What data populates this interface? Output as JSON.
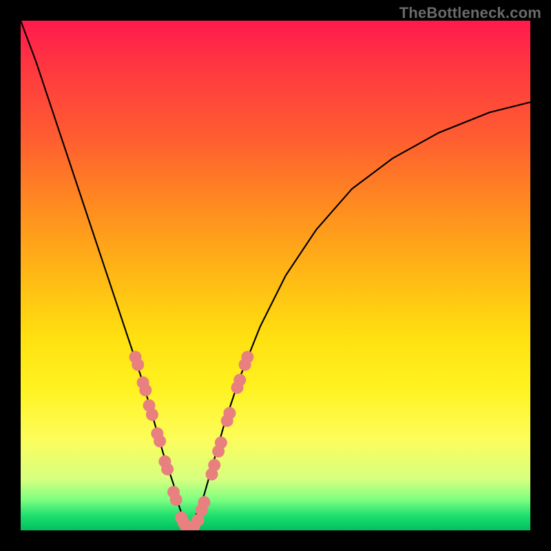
{
  "watermark": "TheBottleneck.com",
  "chart_data": {
    "type": "line",
    "title": "",
    "xlabel": "",
    "ylabel": "",
    "xlim": [
      0,
      100
    ],
    "ylim": [
      0,
      100
    ],
    "x": [
      0,
      3,
      6,
      9,
      12,
      15,
      18,
      21,
      24,
      26,
      28,
      30,
      31,
      32,
      33,
      34,
      36,
      38,
      40,
      43,
      47,
      52,
      58,
      65,
      73,
      82,
      92,
      100
    ],
    "values": [
      100,
      92,
      83,
      74,
      65,
      56,
      47,
      38,
      29,
      22,
      15,
      9,
      5,
      2,
      0,
      2,
      7,
      14,
      21,
      30,
      40,
      50,
      59,
      67,
      73,
      78,
      82,
      84
    ],
    "annotations": [
      {
        "x": 22.5,
        "y": 34
      },
      {
        "x": 23.0,
        "y": 32.5
      },
      {
        "x": 24.0,
        "y": 29
      },
      {
        "x": 24.5,
        "y": 27.5
      },
      {
        "x": 25.2,
        "y": 24.5
      },
      {
        "x": 25.8,
        "y": 22.7
      },
      {
        "x": 26.8,
        "y": 19
      },
      {
        "x": 27.3,
        "y": 17.5
      },
      {
        "x": 28.3,
        "y": 13.5
      },
      {
        "x": 28.8,
        "y": 12
      },
      {
        "x": 30.0,
        "y": 7.5
      },
      {
        "x": 30.5,
        "y": 6
      },
      {
        "x": 31.5,
        "y": 2.5
      },
      {
        "x": 32.0,
        "y": 1.5
      },
      {
        "x": 32.5,
        "y": 0.6
      },
      {
        "x": 33.2,
        "y": 0.3
      },
      {
        "x": 34.0,
        "y": 0.8
      },
      {
        "x": 34.8,
        "y": 2.0
      },
      {
        "x": 35.5,
        "y": 4.0
      },
      {
        "x": 36.0,
        "y": 5.5
      },
      {
        "x": 37.5,
        "y": 11
      },
      {
        "x": 38.0,
        "y": 12.8
      },
      {
        "x": 38.8,
        "y": 15.5
      },
      {
        "x": 39.3,
        "y": 17.2
      },
      {
        "x": 40.5,
        "y": 21.5
      },
      {
        "x": 41.0,
        "y": 23
      },
      {
        "x": 42.5,
        "y": 28
      },
      {
        "x": 43.0,
        "y": 29.5
      },
      {
        "x": 44.0,
        "y": 32.5
      },
      {
        "x": 44.5,
        "y": 34
      }
    ],
    "colors": {
      "curve": "#000000",
      "dots": "#e98080"
    }
  }
}
